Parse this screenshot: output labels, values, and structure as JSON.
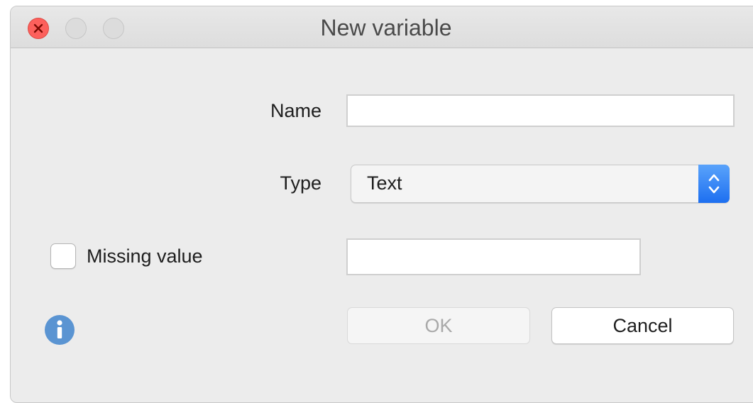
{
  "window": {
    "title": "New variable"
  },
  "form": {
    "name_label": "Name",
    "name_value": "",
    "type_label": "Type",
    "type_selected": "Text",
    "missing_value_label": "Missing value",
    "missing_value_checked": false,
    "missing_value_value": ""
  },
  "buttons": {
    "ok_label": "OK",
    "cancel_label": "Cancel"
  },
  "icons": {
    "close": "close-icon",
    "info": "info-icon",
    "stepper": "chevron-updown-icon"
  },
  "colors": {
    "close_red": "#fc605c",
    "accent_blue": "#1d6ff0",
    "info_blue": "#5a94d2"
  }
}
